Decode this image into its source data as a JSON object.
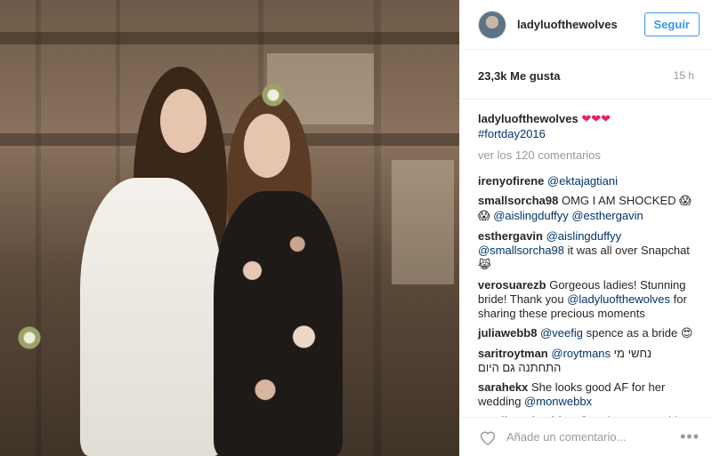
{
  "header": {
    "username": "ladyluofthewolves",
    "follow_label": "Seguir"
  },
  "meta": {
    "likes": "23,3k Me gusta",
    "time": "15 h"
  },
  "caption": {
    "user": "ladyluofthewolves",
    "text": "❤❤❤",
    "hashtag": "#fortday2016"
  },
  "view_all": "ver los 120 comentarios",
  "comments": [
    {
      "user": "irenyofirene",
      "parts": [
        {
          "t": "link",
          "v": "@ektajagtiani"
        }
      ]
    },
    {
      "user": "smallsorcha98",
      "parts": [
        {
          "t": "text",
          "v": "OMG I AM SHOCKED "
        },
        {
          "t": "emoji",
          "v": "😱"
        },
        {
          "t": "text",
          "v": " "
        },
        {
          "t": "emoji",
          "v": "😱"
        },
        {
          "t": "text",
          "v": " "
        },
        {
          "t": "link",
          "v": "@aislingduffyy"
        },
        {
          "t": "text",
          "v": " "
        },
        {
          "t": "link",
          "v": "@esthergavin"
        }
      ]
    },
    {
      "user": "esthergavin",
      "parts": [
        {
          "t": "link",
          "v": "@aislingduffyy"
        },
        {
          "t": "text",
          "v": " "
        },
        {
          "t": "link",
          "v": "@smallsorcha98"
        },
        {
          "t": "text",
          "v": " it was all over Snapchat "
        },
        {
          "t": "emoji",
          "v": "😹"
        }
      ]
    },
    {
      "user": "verosuarezb",
      "parts": [
        {
          "t": "text",
          "v": "Gorgeous ladies! Stunning bride! Thank you "
        },
        {
          "t": "link",
          "v": "@ladyluofthewolves"
        },
        {
          "t": "text",
          "v": " for sharing these precious moments"
        }
      ]
    },
    {
      "user": "juliawebb8",
      "parts": [
        {
          "t": "link",
          "v": "@veefig"
        },
        {
          "t": "text",
          "v": " spence as a bride "
        },
        {
          "t": "emoji",
          "v": "😍"
        }
      ]
    },
    {
      "user": "saritroytman",
      "parts": [
        {
          "t": "link",
          "v": "@roytmans"
        },
        {
          "t": "text",
          "v": " נחשי מי התחתנה גם היום"
        }
      ]
    },
    {
      "user": "sarahekx",
      "parts": [
        {
          "t": "text",
          "v": "She looks good AF for her wedding "
        },
        {
          "t": "link",
          "v": "@monwebbx"
        }
      ]
    },
    {
      "user": "mcclintockashley",
      "parts": [
        {
          "t": "link",
          "v": "@cashmoneymaddy"
        }
      ]
    }
  ],
  "add_comment": {
    "placeholder": "Añade un comentario..."
  },
  "icons": {
    "like": "heart-outline-icon",
    "more": "ellipsis-icon"
  },
  "colors": {
    "link": "#003569",
    "follow": "#3897f0",
    "hearts": "#e0245e"
  }
}
